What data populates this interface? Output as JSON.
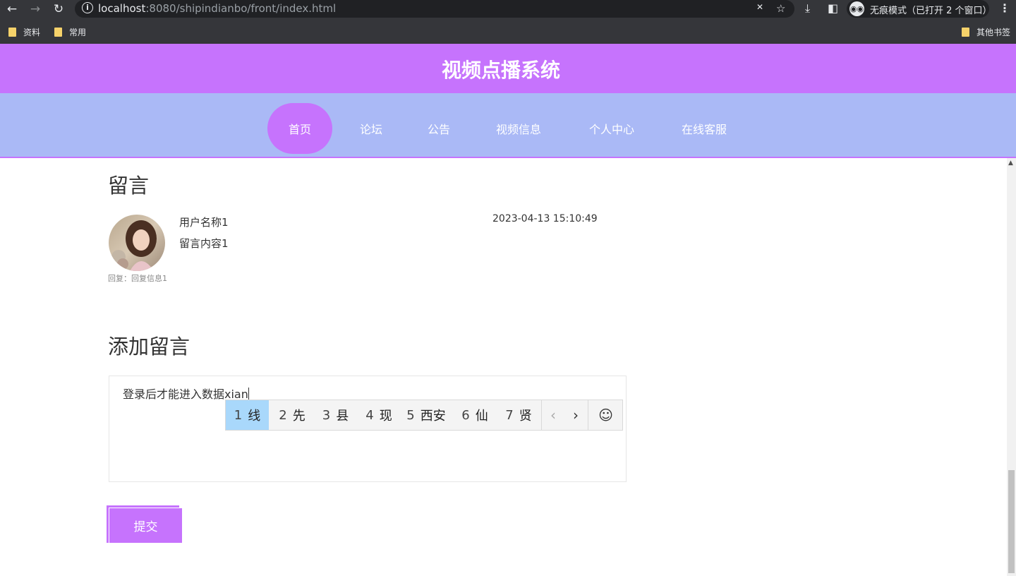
{
  "browser": {
    "url_host": "localhost",
    "url_path": ":8080/shipindianbo/front/index.html",
    "incognito_label": "无痕模式（已打开 2 个窗口）",
    "bookmarks": [
      "资料",
      "常用"
    ],
    "other_bookmarks": "其他书签"
  },
  "site": {
    "title": "视频点播系统",
    "nav": [
      "首页",
      "论坛",
      "公告",
      "视频信息",
      "个人中心",
      "在线客服"
    ],
    "active_nav": "首页"
  },
  "messages_section": {
    "title": "留言",
    "items": [
      {
        "user": "用户名称1",
        "time": "2023-04-13 15:10:49",
        "content": "留言内容1",
        "reply": "回复：回复信息1"
      }
    ]
  },
  "add_message": {
    "title": "添加留言",
    "input_value": "登录后才能进入数据xian",
    "submit_label": "提交"
  },
  "ime": {
    "candidates": [
      {
        "num": "1",
        "text": "线"
      },
      {
        "num": "2",
        "text": "先"
      },
      {
        "num": "3",
        "text": "县"
      },
      {
        "num": "4",
        "text": "现"
      },
      {
        "num": "5",
        "text": "西安"
      },
      {
        "num": "6",
        "text": "仙"
      },
      {
        "num": "7",
        "text": "贤"
      }
    ],
    "selected_index": 0
  },
  "colors": {
    "header": "#c673fd",
    "nav_bar": "#aab9f6",
    "ime_selected": "#a9d8fb"
  }
}
